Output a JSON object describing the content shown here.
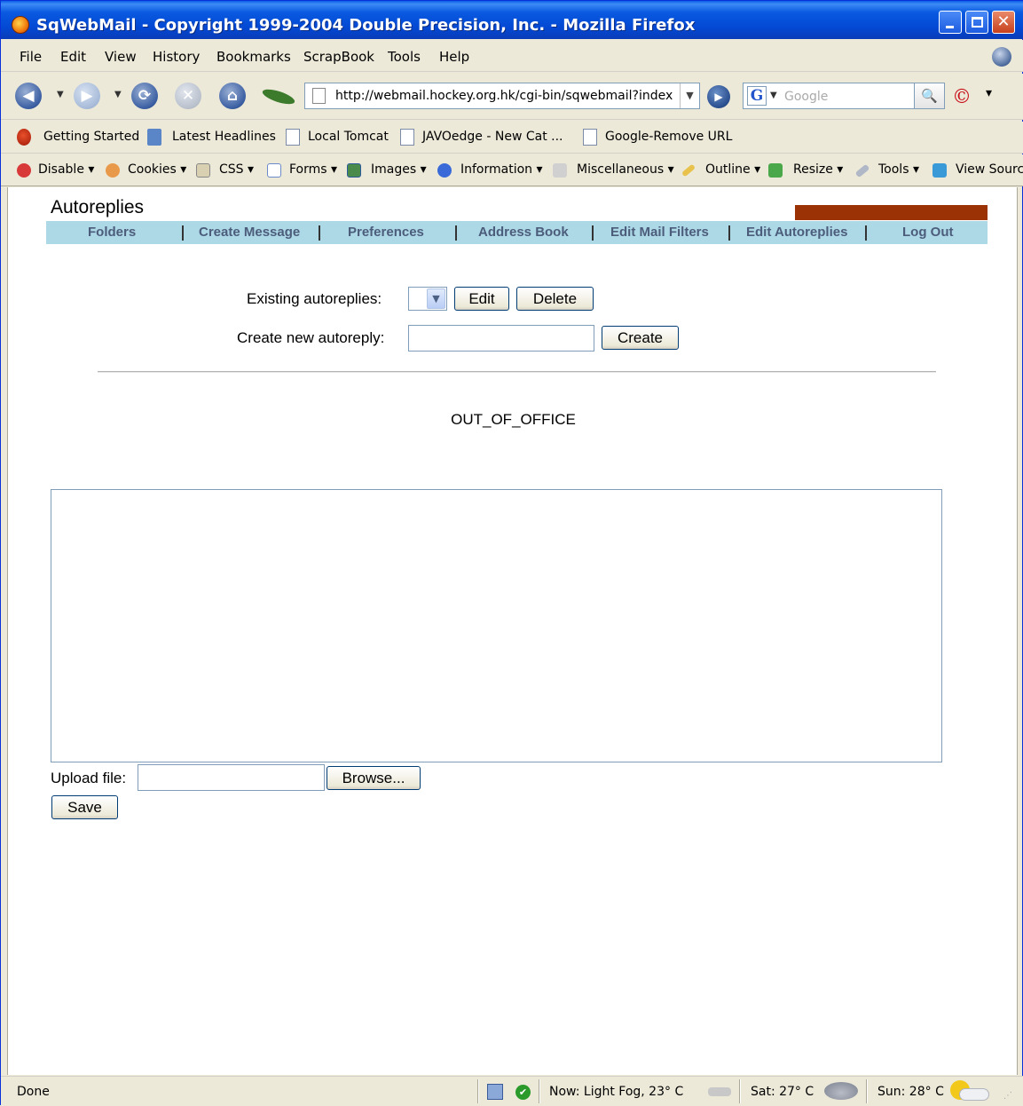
{
  "window": {
    "title": "SqWebMail - Copyright 1999-2004 Double Precision, Inc. - Mozilla Firefox"
  },
  "menu": [
    "File",
    "Edit",
    "View",
    "History",
    "Bookmarks",
    "ScrapBook",
    "Tools",
    "Help"
  ],
  "navbar": {
    "url": "http://webmail.hockey.org.hk/cgi-bin/sqwebmail?index",
    "search_placeholder": "Google"
  },
  "bookmarks": [
    "Getting Started",
    "Latest Headlines",
    "Local Tomcat",
    "JAVOedge - New Cat ...",
    "Google-Remove URL"
  ],
  "devtoolbar": [
    "Disable",
    "Cookies",
    "CSS",
    "Forms",
    "Images",
    "Information",
    "Miscellaneous",
    "Outline",
    "Resize",
    "Tools",
    "View Sourc"
  ],
  "page": {
    "title": "Autoreplies",
    "nav": [
      "Folders",
      "Create Message",
      "Preferences",
      "Address Book",
      "Edit Mail Filters",
      "Edit Autoreplies",
      "Log Out"
    ],
    "existing_label": "Existing autoreplies:",
    "edit_label": "Edit",
    "delete_label": "Delete",
    "create_new_label": "Create new autoreply:",
    "create_label": "Create",
    "autoreply_name": "OUT_OF_OFFICE",
    "upload_label": "Upload file:",
    "browse_label": "Browse...",
    "save_label": "Save"
  },
  "status": {
    "text": "Done",
    "now": "Now: Light Fog, 23° C",
    "sat": "Sat: 27° C",
    "sun": "Sun: 28° C"
  }
}
